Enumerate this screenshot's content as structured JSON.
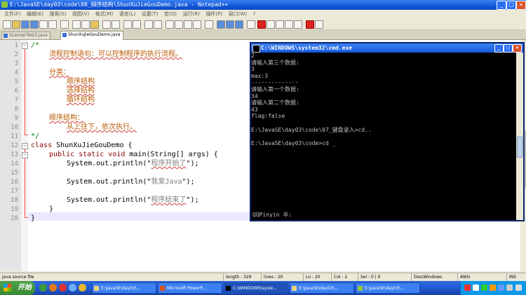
{
  "window": {
    "title": "E:\\JavaSE\\day03\\code\\08_顺序结构\\ShunXuJieGouDemo.java - Notepad++",
    "min": "_",
    "max": "□",
    "close": "×"
  },
  "menu": [
    "文件(F)",
    "编辑(E)",
    "搜索(S)",
    "视图(V)",
    "格式(M)",
    "语言(L)",
    "设置(T)",
    "宏(O)",
    "运行(R)",
    "插件(P)",
    "窗口(W)",
    "?"
  ],
  "tabs": [
    {
      "label": "ScannerTest3.java"
    },
    {
      "label": "ShunXuJieGouDemo.java"
    }
  ],
  "code": {
    "line_numbers": [
      "1",
      "2",
      "3",
      "4",
      "5",
      "6",
      "7",
      "8",
      "9",
      "10",
      "11",
      "12",
      "13",
      "14",
      "15",
      "16",
      "17",
      "18",
      "19",
      "20"
    ],
    "l1": "/*",
    "l2": "流程控制语句：可以控制程序的执行流程。",
    "l4": "分类：",
    "l5": "顺序结构",
    "l6": "选择结构",
    "l7": "循环结构",
    "l9": "顺序结构：",
    "l10": "从上往下，依次执行。",
    "l11": "*/",
    "l12_kw": "class",
    "l12_name": " ShunXuJieGouDemo {",
    "l13_kw": "public static void",
    "l13_rest": " main(String[] args) {",
    "l14_pre": "System.out.println(\"",
    "l14_str": "程序开始了",
    "l14_post": "\");",
    "l16_pre": "System.out.println(\"",
    "l16_str": "我爱Java",
    "l16_post": "\");",
    "l18_pre": "System.out.println(\"",
    "l18_str": "程序结束了",
    "l18_post": "\");",
    "l19": "}",
    "l20": "}"
  },
  "cmd": {
    "title": "C:\\WINDOWS\\system32\\cmd.exe",
    "lines": "2\n请输入第三个数据:\n3\nmax:3\n--------------\n请输入第一个数据:\n34\n请输入第二个数据:\n43\nflag:false\n\nE:\\JavaSE\\day03\\code\\07_键盘录入>cd..\n\nE:\\JavaSE\\day03\\code>cd _",
    "ime": "QQPinyin 半:"
  },
  "status": {
    "file_type": "Java source file",
    "length": "length : 329",
    "lines": "lines : 20",
    "ln": "Ln : 20",
    "col": "Col : 2",
    "sel": "Sel : 0 | 0",
    "eol": "Dos\\Windows",
    "encoding": "ANSI",
    "mode": "INS"
  },
  "taskbar": {
    "start": "开始",
    "tasks": [
      {
        "label": "E:\\JavaSE\\day03\\..."
      },
      {
        "label": "Microsoft PowerP..."
      },
      {
        "label": "C:\\WINDOWS\\syste..."
      },
      {
        "label": "E:\\JavaSE\\day03\\..."
      },
      {
        "label": "E:\\JavaSE\\day03\\..."
      }
    ]
  }
}
